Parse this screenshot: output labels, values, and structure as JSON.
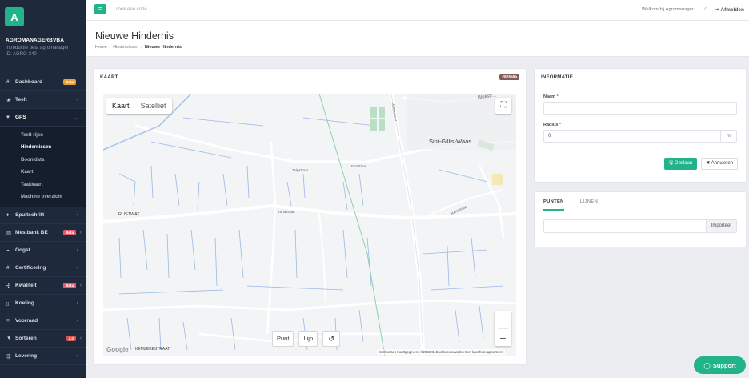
{
  "sidebar": {
    "logo_letter": "A",
    "company_name": "AGROMANAGERBVBA",
    "company_sub": "Introductie beta agromanager",
    "company_id": "ID: AGRO-340",
    "items": [
      {
        "label": "Dashboard",
        "icon": "#",
        "badge": "Beta"
      },
      {
        "label": "Teelt",
        "icon": "❀",
        "chevron": "‹"
      },
      {
        "label": "GPS",
        "icon": "♥",
        "chevron": "⌄"
      },
      {
        "label": "Spuitschrift",
        "icon": "♦",
        "chevron": "‹"
      },
      {
        "label": "Mestbank BE",
        "icon": "▥",
        "badge": "Beta",
        "chevron": "‹"
      },
      {
        "label": "Oogst",
        "icon": "◒",
        "chevron": "‹"
      },
      {
        "label": "Certificering",
        "icon": "#",
        "chevron": "‹"
      },
      {
        "label": "Kwaliteit",
        "icon": "✣",
        "badge": "Beta",
        "chevron": "‹"
      },
      {
        "label": "Koeling",
        "icon": "▯",
        "chevron": "‹"
      },
      {
        "label": "Voorraad",
        "icon": "≡",
        "chevron": "‹"
      },
      {
        "label": "Sorteren",
        "icon": "▼",
        "badge": "2.0",
        "chevron": "‹"
      },
      {
        "label": "Levering",
        "icon": "⇶",
        "chevron": "‹"
      }
    ],
    "gps_sub": [
      "Teelt rijen",
      "Hindernissen",
      "Boomdata",
      "Kaart",
      "Taakkaart",
      "Machine overzicht"
    ]
  },
  "topbar": {
    "menu_icon": "≡",
    "search_placeholder": "Zoek een code...",
    "welcome": "Welkom bij Agromanager.",
    "logout": "⇥ Afmelden"
  },
  "header": {
    "title": "Nieuwe Hindernis",
    "crumbs": [
      "Home",
      "Hindernissen",
      "Nieuwe Hindernis"
    ]
  },
  "map_panel": {
    "title": "KAART",
    "color_badge": "#825a5a",
    "map_type": [
      "Kaart",
      "Satelliet"
    ],
    "draw": [
      "Punt",
      "Lijn",
      "↺"
    ],
    "zoom_in": "+",
    "zoom_out": "−",
    "google": "Google",
    "attribution": "Sneltoetsen   Kaartgegevens ©2022   Gebruiksvoorwaarden   Een kaartfout rapporteren",
    "labels": {
      "town": "Sint-Gillis-Waas",
      "rustwat": "RUSTWAT",
      "kemzeke": "KEMZEKESTRAAT",
      "bloksti": "Blokstr...",
      "molenstraat": "Molenstraat",
      "fortstraat": "Fortstraat",
      "tulpstraat": "Tulpstraat",
      "kerkstraat": "Kerkstraat",
      "zandstraat": "Zandstraat"
    }
  },
  "info_panel": {
    "title": "INFORMATIE",
    "name_label": "Naam",
    "radius_label": "Radius",
    "radius_value": "0",
    "radius_unit": "m",
    "save": "🖫 Opslaan",
    "cancel": "✖ Annuleren"
  },
  "points_panel": {
    "tabs": [
      "PUNTEN",
      "LIJNEN"
    ],
    "import": "Importeer"
  },
  "support": "Support"
}
